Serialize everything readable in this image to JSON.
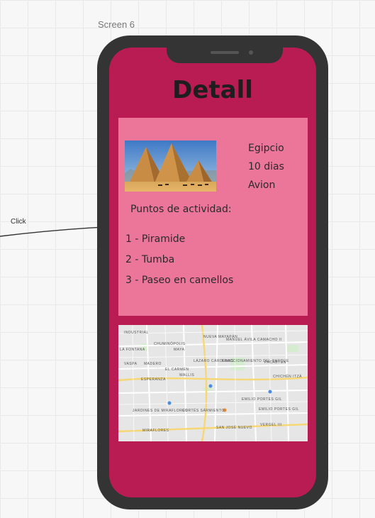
{
  "canvas": {
    "screen_label": "Screen 6",
    "annotation": "Click"
  },
  "detail": {
    "title": "Detall",
    "trip": {
      "image_icon": "pyramids-photo",
      "destination": "Egipcio",
      "duration": "10 dias",
      "transport": "Avion"
    },
    "activities_heading": "Puntos de actividad:",
    "activities": [
      "1 - Piramide",
      "2 - Tumba",
      "3 - Paseo en camellos"
    ]
  },
  "map": {
    "icon": "map-thumbnail",
    "labels": [
      "INDUSTRIAL",
      "CHUMINÓPOLIS",
      "NUEVA MAYAPÁN",
      "MANUEL ÁVILA CAMACHO II",
      "LA FONTANA",
      "MAYA",
      "VASPA",
      "MADERO",
      "EL CARMEN",
      "LÁZARO CÁRDENAS",
      "FRACCIONAMIENTO DEL PARQUE",
      "PACABTÚN",
      "WALLIS",
      "ESPERANZA",
      "CHICHÉN ITZÁ",
      "EMILIO PORTES GIL",
      "JARDINES DE MIRAFLORES",
      "CORTÉS SÁRMIENTO",
      "EMILIO PORTES GIL",
      "SAN JOSÉ NUEVO",
      "MIRAFLORES",
      "VERGEL III"
    ]
  },
  "colors": {
    "screen_bg": "#b81c52",
    "card_bg": "#ec7699",
    "phone_frame": "#343434"
  }
}
